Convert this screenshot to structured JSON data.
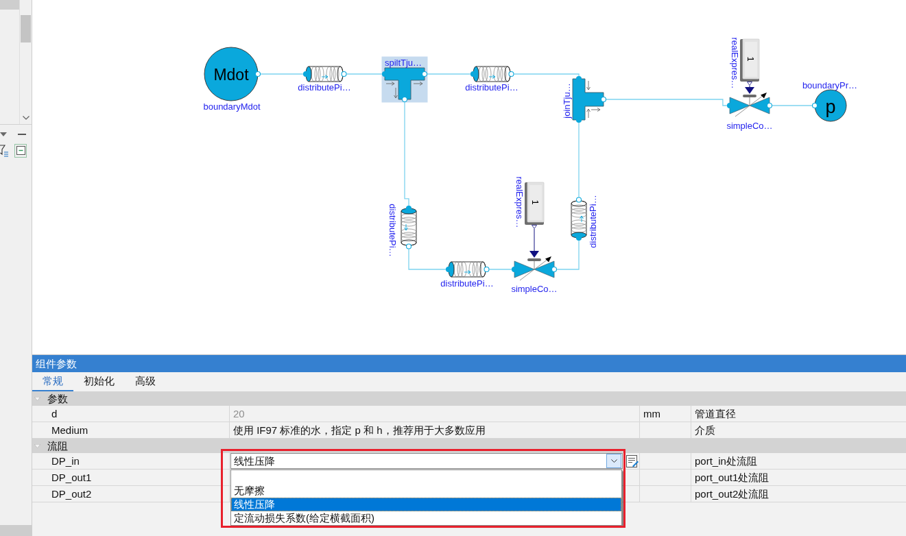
{
  "diagram": {
    "nodes": [
      {
        "kind": "source",
        "symbol": "Mdot",
        "label": "boundaryMdot",
        "selected": false
      },
      {
        "kind": "pipe",
        "label": "distributePi…",
        "selected": false
      },
      {
        "kind": "split_tee",
        "label": "spiltTju…",
        "selected": true
      },
      {
        "kind": "pipe",
        "label": "distributePi…",
        "selected": false
      },
      {
        "kind": "join_tee",
        "label": "joinTju…",
        "selected": false
      },
      {
        "kind": "expression",
        "symbol": "1",
        "label": "realExpres…",
        "selected": false
      },
      {
        "kind": "valve",
        "label": "simpleCo…",
        "selected": false
      },
      {
        "kind": "boundary",
        "symbol": "p",
        "label": "boundaryPr…",
        "selected": false
      },
      {
        "kind": "pipe",
        "label": "distributePi…",
        "selected": false
      },
      {
        "kind": "pipe",
        "label": "distributePi…",
        "selected": false
      },
      {
        "kind": "expression",
        "symbol": "1",
        "label": "realExpres…",
        "selected": false
      },
      {
        "kind": "valve",
        "label": "simpleCo…",
        "selected": false
      },
      {
        "kind": "pipe",
        "label": "distributePi…",
        "selected": false
      }
    ]
  },
  "parameter_panel": {
    "title": "组件参数",
    "tabs": [
      {
        "label": "常规",
        "selected": true
      },
      {
        "label": "初始化",
        "selected": false
      },
      {
        "label": "高级",
        "selected": false
      }
    ],
    "groups": [
      {
        "title": "参数",
        "expanded": true,
        "rows": [
          {
            "name": "d",
            "value": "20",
            "greyed": true,
            "unit": "mm",
            "description": "管道直径"
          },
          {
            "name": "Medium",
            "value": "使用 IF97 标准的水，指定 p 和 h，推荐用于大多数应用",
            "greyed": false,
            "description": "介质"
          }
        ]
      },
      {
        "title": "流阻",
        "expanded": true,
        "rows": [
          {
            "name": "DP_in",
            "dropdown": {
              "value": "线性压降",
              "expanded": true,
              "highlighted": true,
              "options": [
                {
                  "label": "无摩擦",
                  "selected": false
                },
                {
                  "label": "线性压降",
                  "selected": true
                },
                {
                  "label": "定流动损失系数(给定横截面积)",
                  "selected": false
                }
              ]
            },
            "description": "port_in处流阻"
          },
          {
            "name": "DP_out1",
            "description": "port_out1处流阻"
          },
          {
            "name": "DP_out2",
            "description": "port_out2处流阻"
          }
        ]
      }
    ]
  }
}
